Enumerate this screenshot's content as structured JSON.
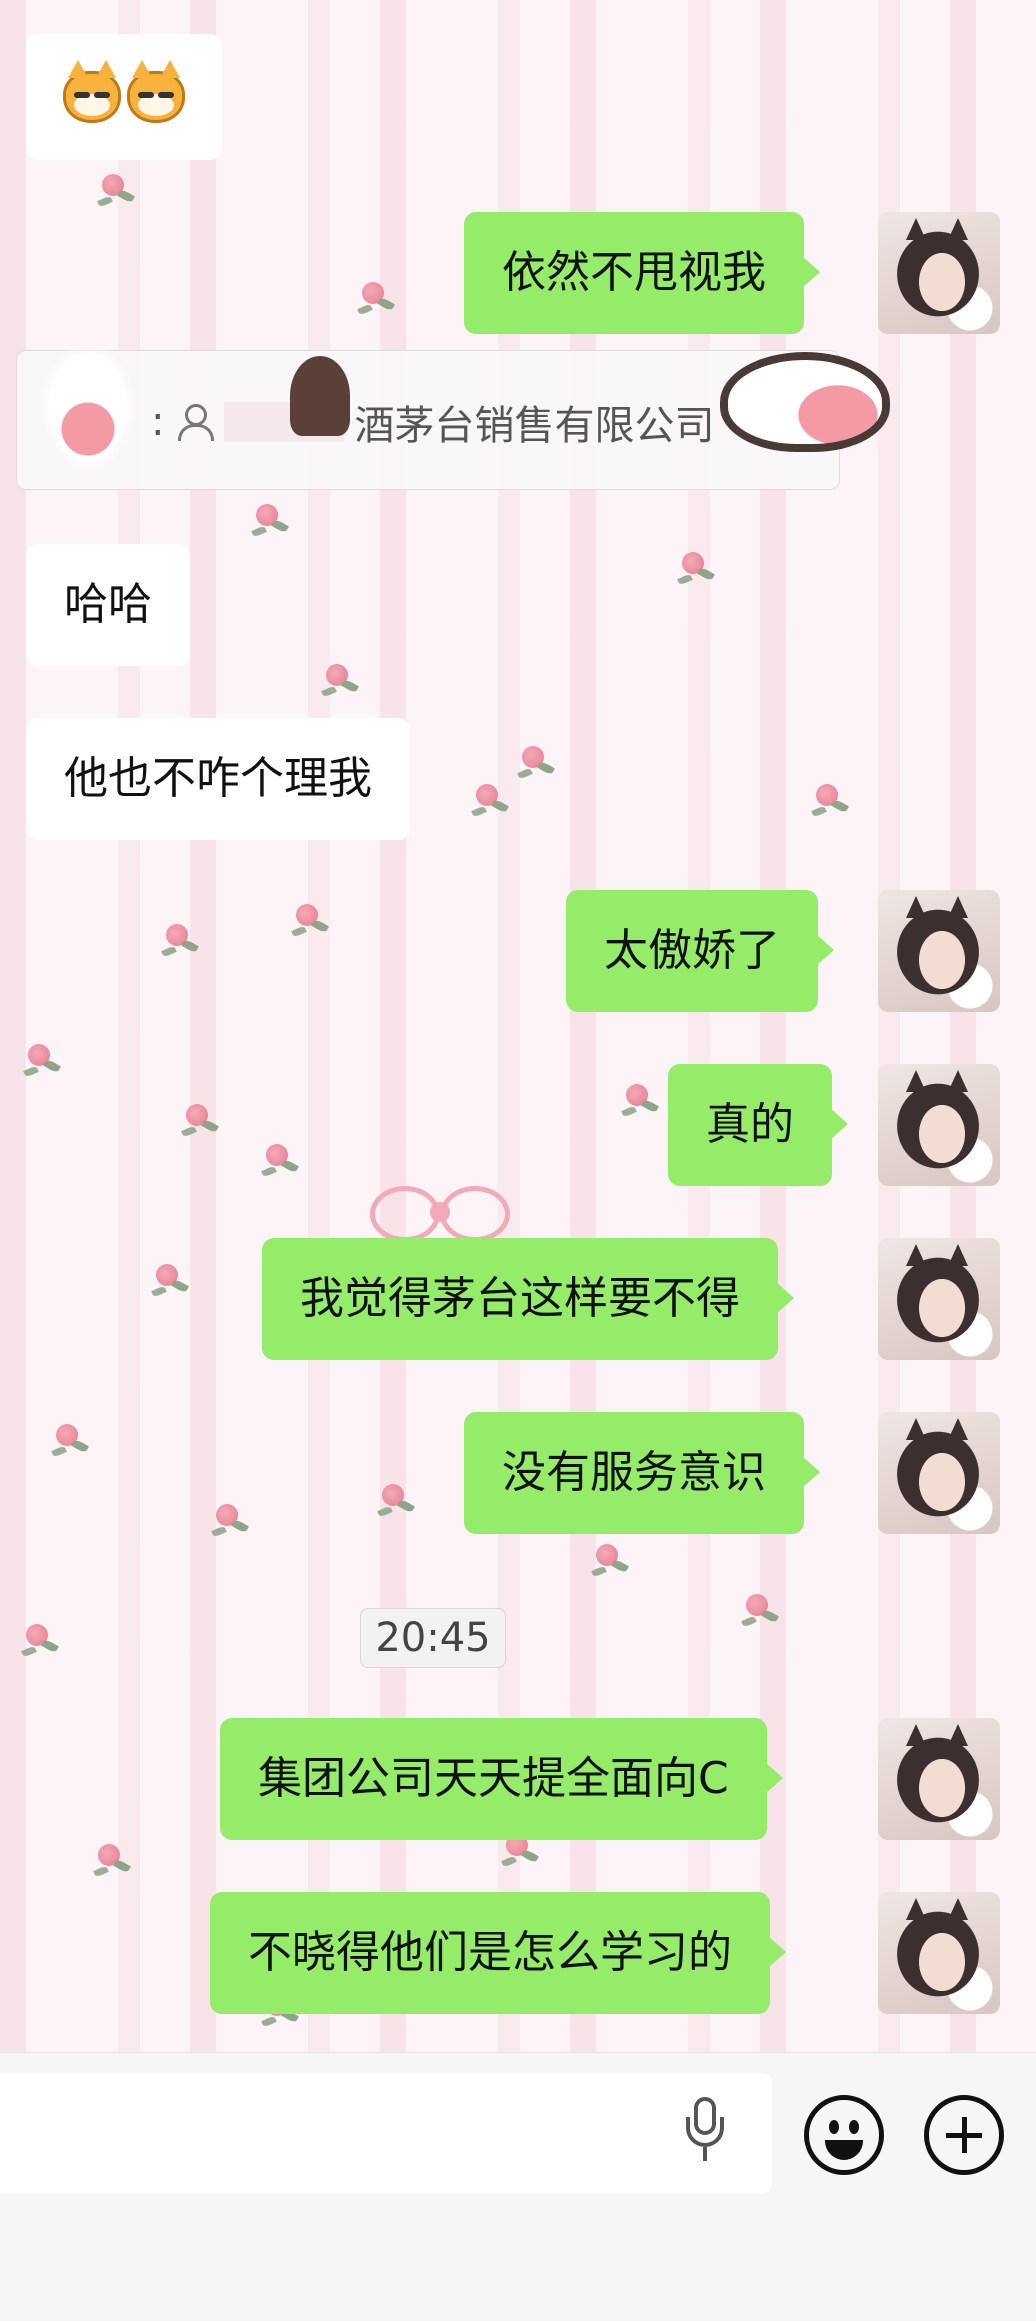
{
  "messages": [
    {
      "side": "in",
      "type": "sticker",
      "sticker_name": "doge-cat-emoji-pair"
    },
    {
      "side": "out",
      "text": "依然不甩视我"
    },
    {
      "side": "in",
      "type": "card",
      "text": "酒茅台销售有限公司"
    },
    {
      "side": "in",
      "text": "哈哈"
    },
    {
      "side": "in",
      "text": "他也不咋个理我"
    },
    {
      "side": "out",
      "text": "太傲娇了"
    },
    {
      "side": "out",
      "text": "真的"
    },
    {
      "side": "out",
      "text": "我觉得茅台这样要不得"
    },
    {
      "side": "out",
      "text": "没有服务意识"
    },
    {
      "side": "out",
      "text": "集团公司天天提全面向C"
    },
    {
      "side": "out",
      "text": "不晓得他们是怎么学习的"
    }
  ],
  "timestamp": "20:45",
  "card": {
    "label": "酒茅台销售有限公司",
    "icon": "person-icon"
  },
  "input_bar": {
    "placeholder": "",
    "icons": [
      "microphone-icon",
      "emoji-icon",
      "plus-icon"
    ]
  },
  "colors": {
    "outgoing_bubble": "#95ec69",
    "incoming_bubble": "#ffffff"
  }
}
